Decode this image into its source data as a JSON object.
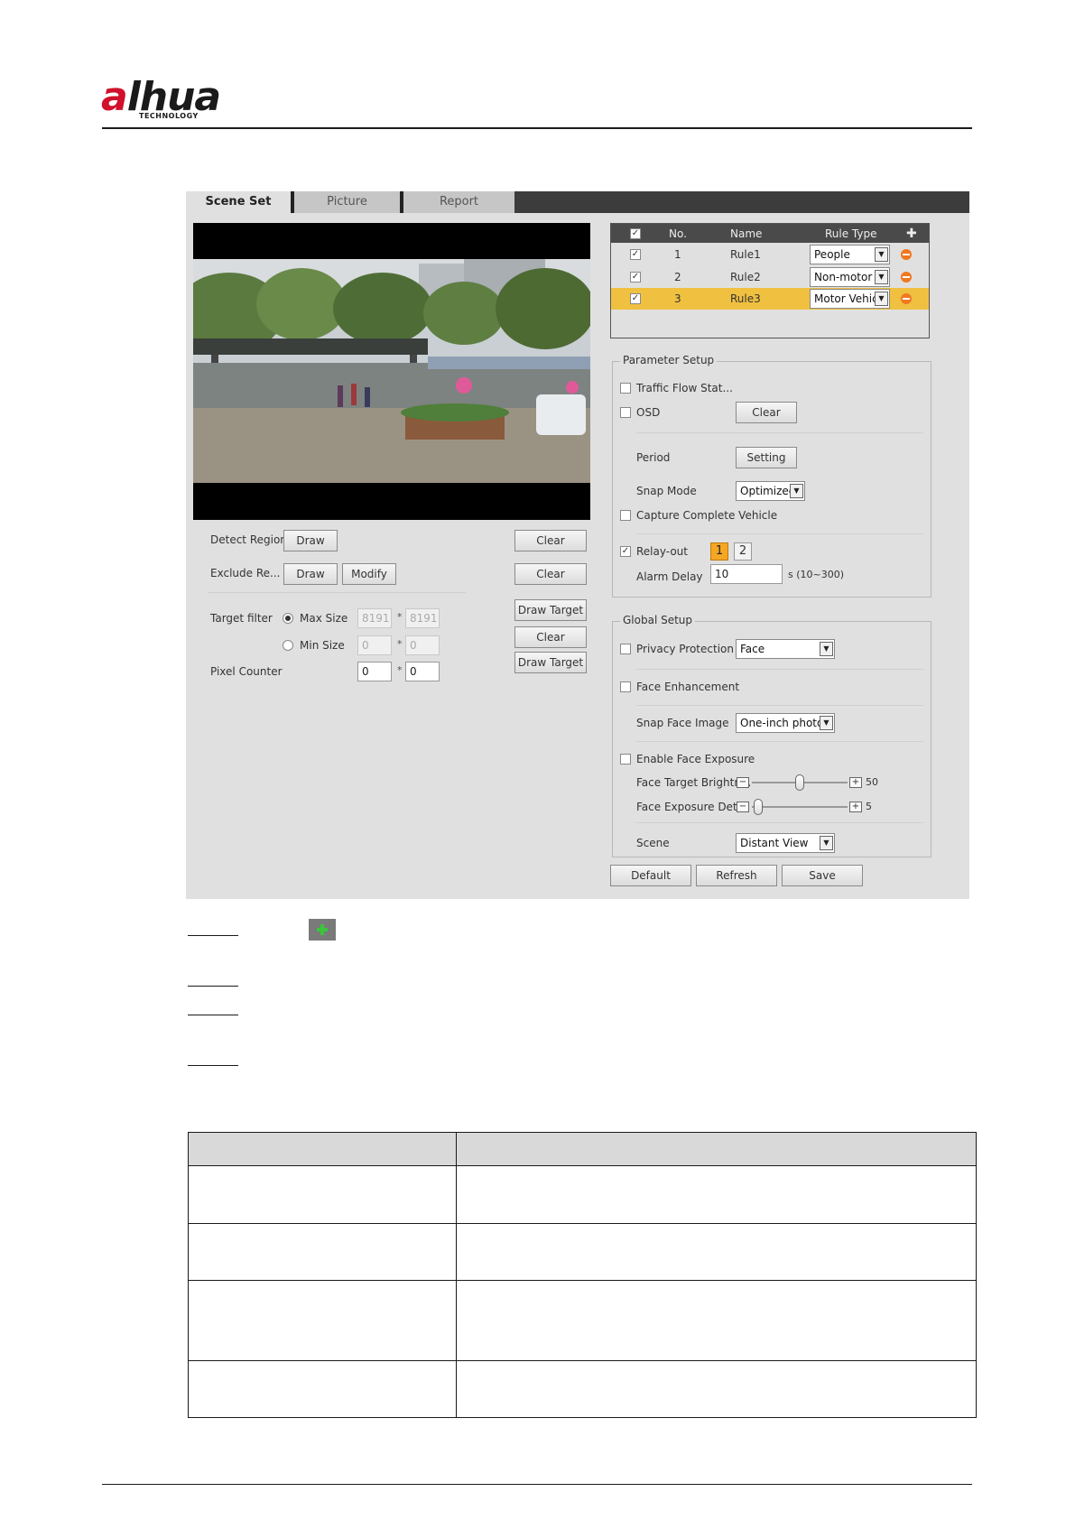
{
  "brand": {
    "name": "alhua",
    "tagline": "TECHNOLOGY"
  },
  "tabs": [
    "Scene Set",
    "Picture",
    "Report"
  ],
  "left_panel": {
    "detect_region": {
      "label": "Detect Region",
      "draw": "Draw",
      "clear": "Clear"
    },
    "exclude_region": {
      "label": "Exclude Re...",
      "draw": "Draw",
      "modify": "Modify",
      "clear": "Clear"
    },
    "target_filter": {
      "label": "Target filter",
      "max_size": {
        "label": "Max Size",
        "w": "8191",
        "h": "8191",
        "selected": true
      },
      "min_size": {
        "label": "Min Size",
        "w": "0",
        "h": "0",
        "selected": false
      },
      "draw_target": "Draw Target",
      "clear": "Clear"
    },
    "pixel_counter": {
      "label": "Pixel Counter",
      "w": "0",
      "h": "0",
      "draw_target": "Draw Target"
    },
    "separator_star": "*"
  },
  "rules": {
    "headers": {
      "no": "No.",
      "name": "Name",
      "type": "Rule Type"
    },
    "rows": [
      {
        "no": "1",
        "name": "Rule1",
        "type": "People",
        "checked": true,
        "selected": false
      },
      {
        "no": "2",
        "name": "Rule2",
        "type": "Non-motor V",
        "checked": true,
        "selected": false
      },
      {
        "no": "3",
        "name": "Rule3",
        "type": "Motor Vehic",
        "checked": true,
        "selected": true
      }
    ]
  },
  "parameter_setup": {
    "title": "Parameter Setup",
    "traffic_flow": "Traffic Flow Stat...",
    "osd": "OSD",
    "clear": "Clear",
    "period": "Period",
    "setting": "Setting",
    "snap_mode": "Snap Mode",
    "snap_mode_value": "Optimized",
    "capture_complete": "Capture Complete Vehicle",
    "relay_out": "Relay-out",
    "relay_1": "1",
    "relay_2": "2",
    "alarm_delay": "Alarm Delay",
    "alarm_delay_value": "10",
    "alarm_delay_range": "s (10~300)"
  },
  "global_setup": {
    "title": "Global Setup",
    "privacy": "Privacy Protection",
    "privacy_value": "Face",
    "face_enh": "Face Enhancement",
    "snap_face": "Snap Face Image",
    "snap_face_value": "One-inch photo",
    "enable_exposure": "Enable Face Exposure",
    "target_brightness": "Face Target Brightn...",
    "target_brightness_value": "50",
    "exposure_detect": "Face Exposure Det...",
    "exposure_detect_value": "5",
    "scene": "Scene",
    "scene_value": "Distant View",
    "slider_minus": "−",
    "slider_plus": "+"
  },
  "footer_buttons": {
    "default": "Default",
    "refresh": "Refresh",
    "save": "Save"
  },
  "colors": {
    "selected_row": "#f0c040",
    "relay_active": "#f5a623",
    "delete": "#f07820",
    "add": "#39c739",
    "brand_red": "#d0112b"
  }
}
